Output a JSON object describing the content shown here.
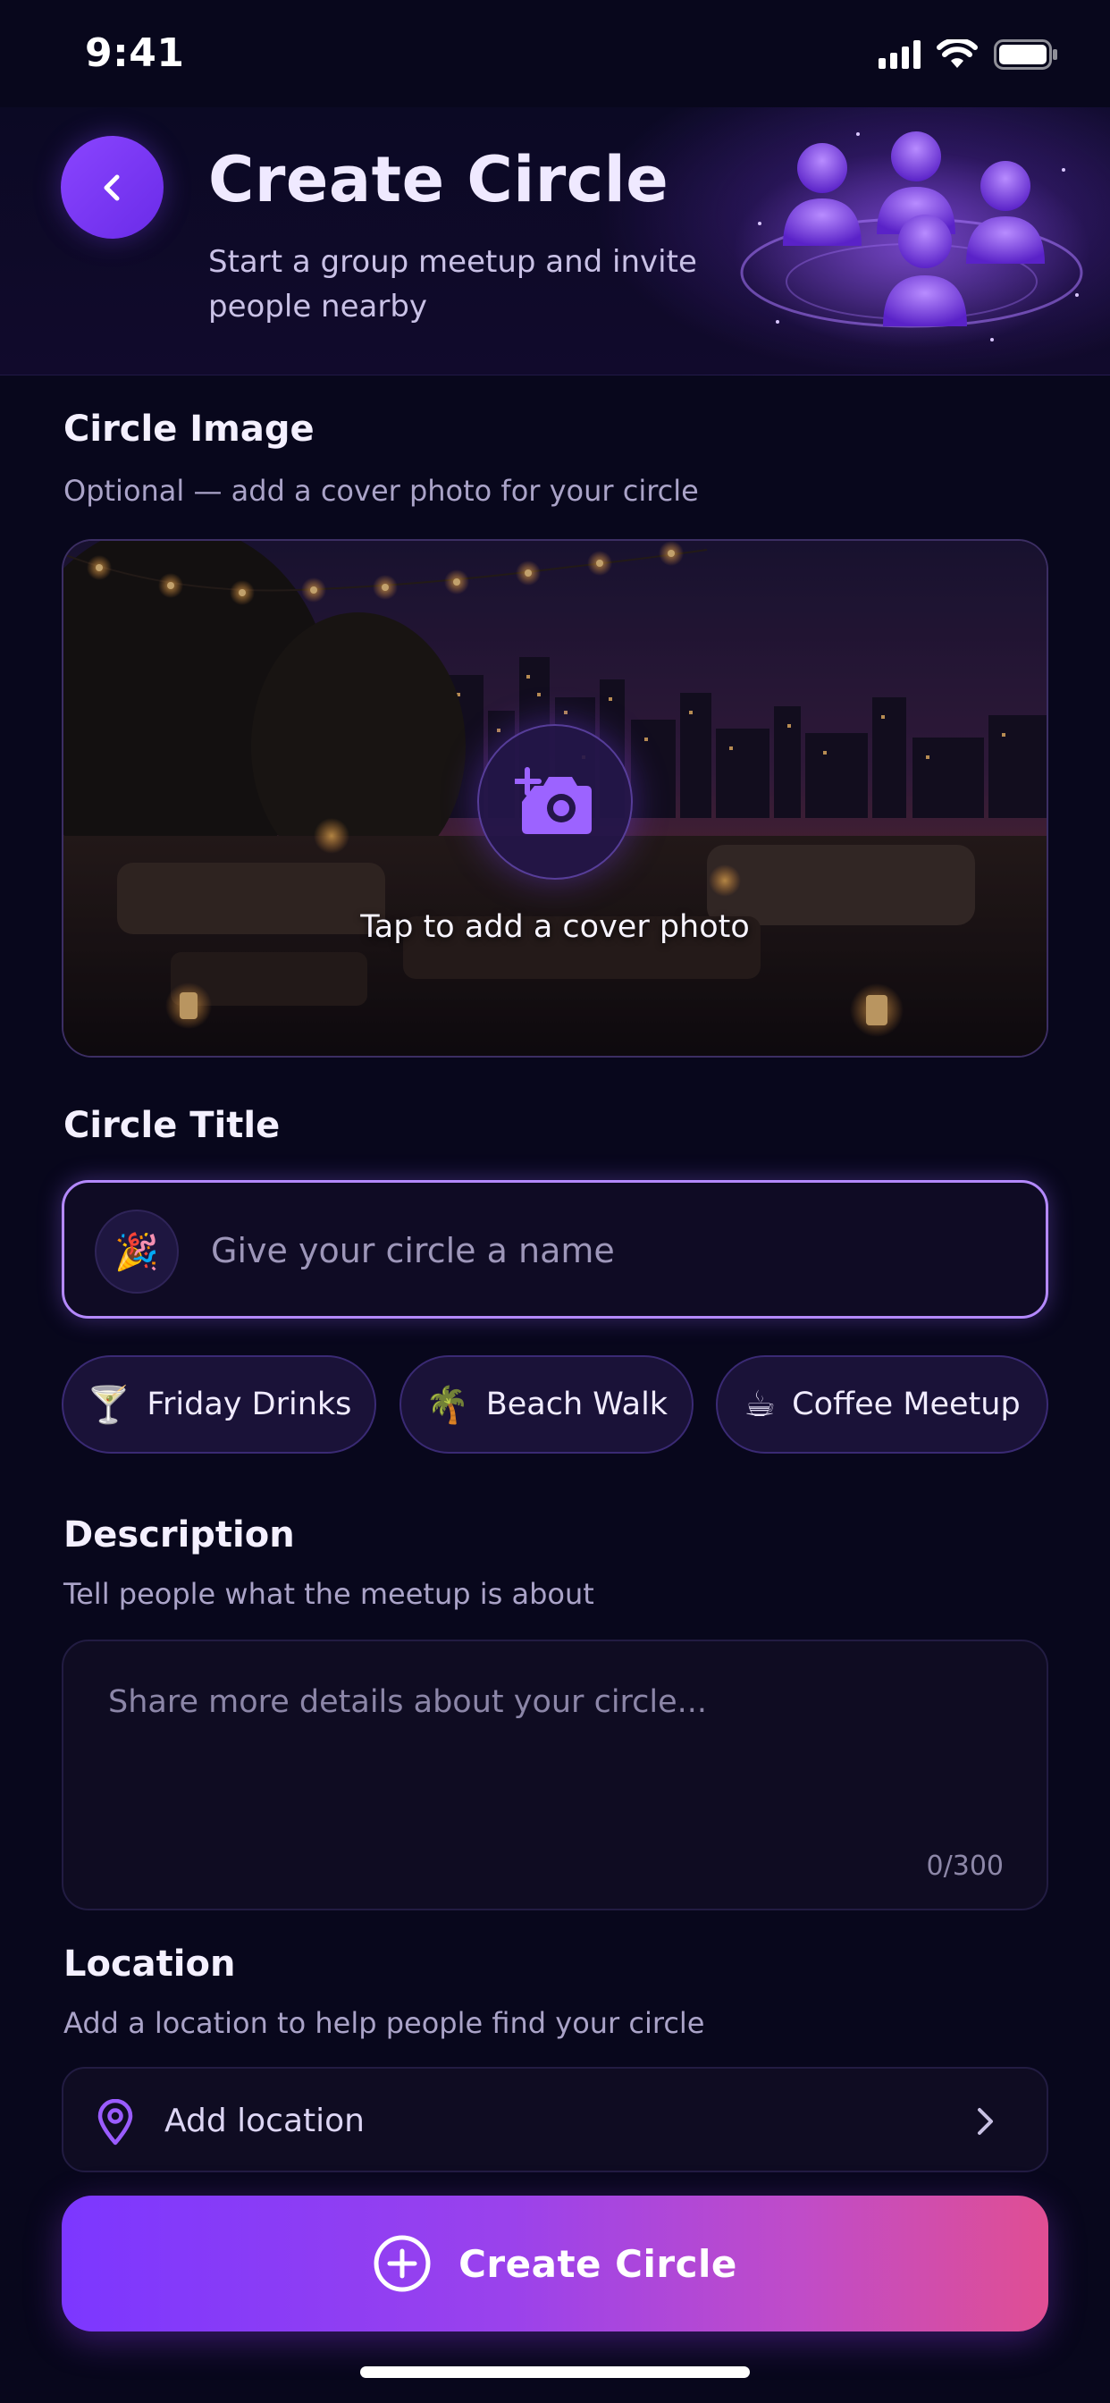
{
  "status_bar": {
    "time": "9:41"
  },
  "header": {
    "title": "Create Circle",
    "subtitle": "Start a group meetup and invite people nearby"
  },
  "circle_image": {
    "title": "Circle Image",
    "hint": "Optional — add a cover photo for your circle",
    "cta": "Tap to add a cover photo"
  },
  "circle_title": {
    "title": "Circle Title",
    "emoji": "🎉",
    "placeholder": "Give your circle a name",
    "value": "",
    "suggestions": [
      {
        "emoji": "🍸",
        "label": "Friday Drinks"
      },
      {
        "emoji": "🌴",
        "label": "Beach Walk"
      },
      {
        "emoji": "☕",
        "label": "Coffee Meetup"
      }
    ]
  },
  "description": {
    "title": "Description",
    "hint": "Tell people what the meetup is about",
    "placeholder": "Share more details about your circle...",
    "char_count": "0/300"
  },
  "location": {
    "title": "Location",
    "hint": "Add a location to help people find your circle",
    "label": "Add location"
  },
  "submit": {
    "label": "Create Circle"
  },
  "colors": {
    "accent": "#7c37ff",
    "gradient_end": "#e04e93",
    "background": "#08071c",
    "input_border": "#b489ff"
  }
}
